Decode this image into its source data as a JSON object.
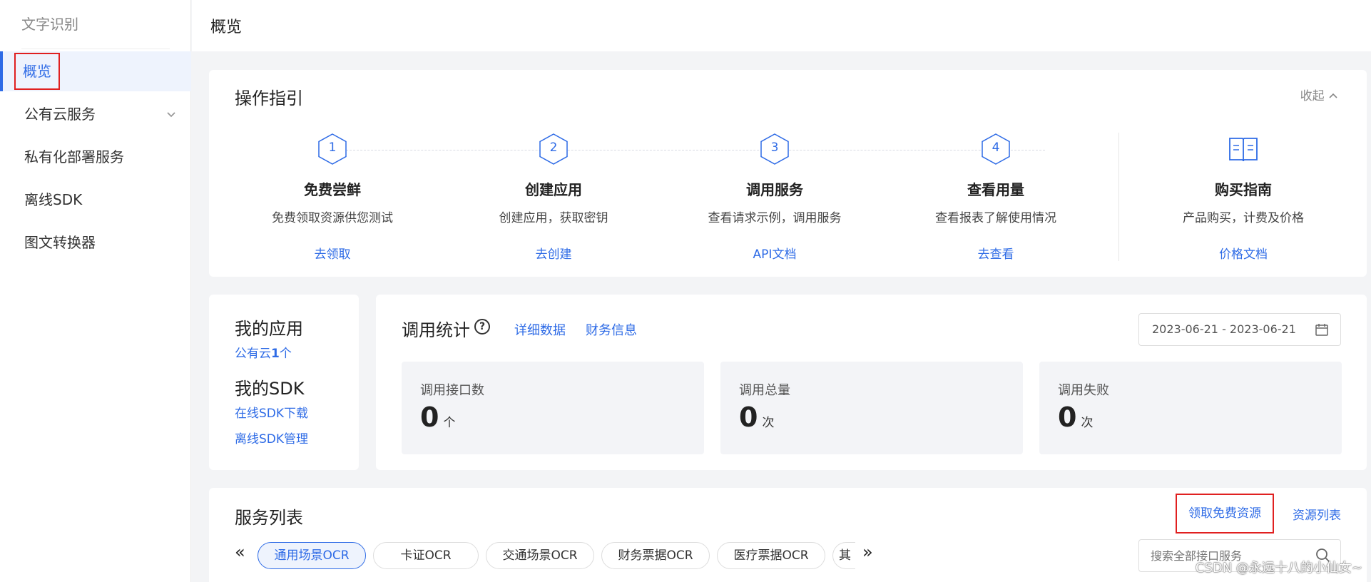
{
  "sidebar": {
    "title": "文字识别",
    "items": [
      {
        "label": "概览"
      },
      {
        "label": "公有云服务"
      },
      {
        "label": "私有化部署服务"
      },
      {
        "label": "离线SDK"
      },
      {
        "label": "图文转换器"
      }
    ]
  },
  "header": {
    "title": "概览"
  },
  "guide": {
    "title": "操作指引",
    "collapse_label": "收起",
    "steps": [
      {
        "num": "1",
        "title": "免费尝鲜",
        "desc": "免费领取资源供您测试",
        "link": "去领取"
      },
      {
        "num": "2",
        "title": "创建应用",
        "desc": "创建应用，获取密钥",
        "link": "去创建"
      },
      {
        "num": "3",
        "title": "调用服务",
        "desc": "查看请求示例，调用服务",
        "link": "API文档"
      },
      {
        "num": "4",
        "title": "查看用量",
        "desc": "查看报表了解使用情况",
        "link": "去查看"
      }
    ],
    "buy": {
      "title": "购买指南",
      "desc": "产品购买，计费及价格",
      "link": "价格文档"
    }
  },
  "myapps": {
    "apps_title": "我的应用",
    "public_cloud_prefix": "公有云",
    "public_cloud_count": "1",
    "public_cloud_suffix": "个",
    "sdk_title": "我的SDK",
    "online_sdk": "在线SDK下载",
    "offline_sdk": "离线SDK管理"
  },
  "stats": {
    "title": "调用统计",
    "help_icon_text": "?",
    "detail_link": "详细数据",
    "finance_link": "财务信息",
    "date_range": "2023-06-21 - 2023-06-21",
    "metrics": [
      {
        "label": "调用接口数",
        "value": "0",
        "unit": "个"
      },
      {
        "label": "调用总量",
        "value": "0",
        "unit": "次"
      },
      {
        "label": "调用失败",
        "value": "0",
        "unit": "次"
      }
    ]
  },
  "services": {
    "title": "服务列表",
    "free_resource": "领取免费资源",
    "resource_list": "资源列表",
    "prev_icon": "«",
    "next_icon": "»",
    "tabs": [
      {
        "label": "通用场景OCR"
      },
      {
        "label": "卡证OCR"
      },
      {
        "label": "交通场景OCR"
      },
      {
        "label": "财务票据OCR"
      },
      {
        "label": "医疗票据OCR"
      },
      {
        "label": "其"
      }
    ],
    "search_placeholder": "搜索全部接口服务"
  },
  "watermark": "CSDN @永远十八的小仙女~",
  "colors": {
    "accent": "#2e6be6",
    "highlight_box": "#e02020"
  }
}
